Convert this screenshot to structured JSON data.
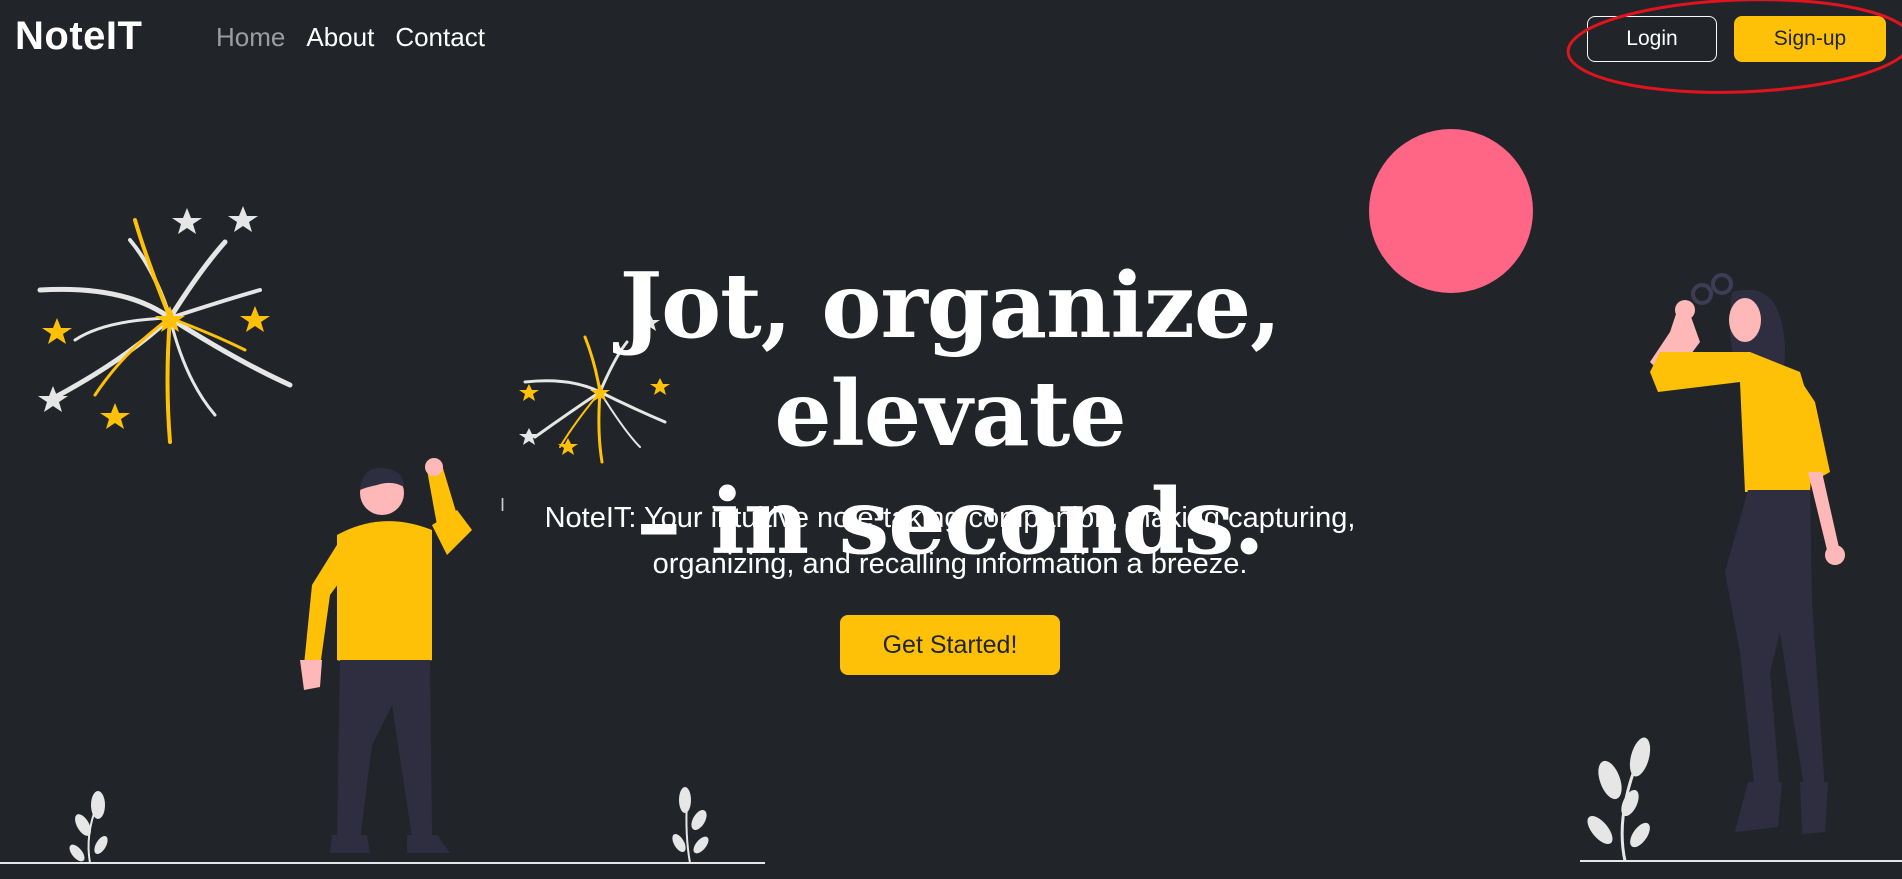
{
  "navbar": {
    "brand": "NoteIT",
    "links": [
      {
        "label": "Home",
        "active": true
      },
      {
        "label": "About",
        "active": false
      },
      {
        "label": "Contact",
        "active": false
      }
    ],
    "login_label": "Login",
    "signup_label": "Sign-up"
  },
  "hero": {
    "title_line1": "Jot, organize, elevate",
    "title_line2": "– in seconds.",
    "description_line1": "NoteIT: Your intuitive note-taking companion, making capturing,",
    "description_line2": "organizing, and recalling information a breeze.",
    "cta_label": "Get Started!"
  },
  "colors": {
    "background": "#212529",
    "accent": "#ffc107",
    "circle": "#ff6584",
    "annotation": "#e0141e",
    "figure_dark": "#2f2e41"
  },
  "icons": [
    "fireworks-icon",
    "plant-icon",
    "text-cursor-icon"
  ]
}
